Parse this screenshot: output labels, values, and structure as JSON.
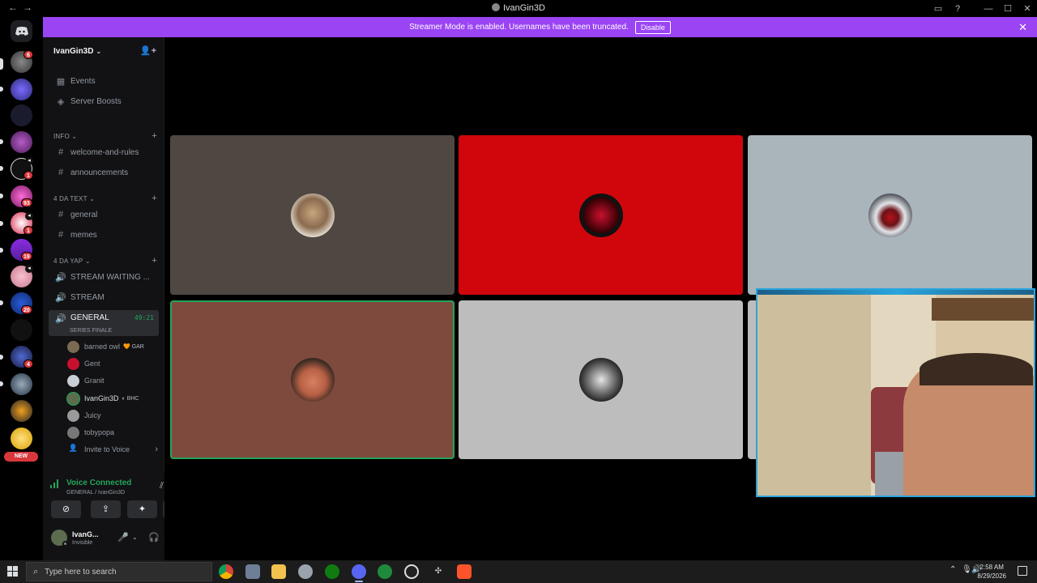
{
  "window": {
    "title": "IvanGin3D",
    "back_glyph": "←",
    "forward_glyph": "→",
    "inbox_glyph": "▭",
    "help_glyph": "?",
    "minimize_glyph": "—",
    "maximize_glyph": "☐",
    "close_glyph": "✕"
  },
  "banner": {
    "message": "Streamer Mode is enabled. Usernames have been truncated.",
    "disable_label": "Disable",
    "close_glyph": "✕",
    "color": "#9b44f4"
  },
  "servers": {
    "home_icon": "discord-logo-icon",
    "badges": [
      "6",
      "1",
      "93",
      "1",
      "19",
      "20",
      "4"
    ],
    "new_label": "NEW"
  },
  "sidebar": {
    "server_name": "IvanGin3D",
    "caret_glyph": "⌄",
    "invite_glyph": "👤+",
    "top_items": [
      {
        "label": "Events",
        "icon": "calendar-icon",
        "glyph": "▦"
      },
      {
        "label": "Server Boosts",
        "icon": "boost-icon",
        "glyph": "◈"
      }
    ],
    "categories": [
      {
        "name": "INFO",
        "caret": "⌄",
        "plus": "+"
      },
      {
        "name": "4 DA TEXT",
        "caret": "⌄",
        "plus": "+"
      },
      {
        "name": "4 DA YAP",
        "caret": "⌄",
        "plus": "+"
      }
    ],
    "text_channels_info": [
      "welcome-and-rules",
      "announcements"
    ],
    "text_channels_text": [
      "general",
      "memes"
    ],
    "voice_channels": [
      "STREAM WAITING ...",
      "STREAM"
    ],
    "active_voice": {
      "name": "GENERAL",
      "timer": "49:21",
      "status": "SERIES FINALE"
    },
    "members": [
      {
        "name": "barned owl",
        "tag": "🧡 GAR",
        "color": "#7b6a52"
      },
      {
        "name": "Gent",
        "tag": "",
        "color": "#c8102e"
      },
      {
        "name": "Granit",
        "tag": "",
        "color": "#c9ced4"
      },
      {
        "name": "IvanGin3D",
        "tag": "◐ BHC",
        "color": "#5b6c4f"
      },
      {
        "name": "Juicy",
        "tag": "",
        "color": "#9a9a9a"
      },
      {
        "name": "tobypopa",
        "tag": "",
        "color": "#777"
      }
    ],
    "invite_to_voice": "Invite to Voice",
    "chevron_right": "›",
    "hash_glyph": "#",
    "speaker_glyph": "🔊"
  },
  "voice_panel": {
    "title": "Voice Connected",
    "location": "GENERAL / IvanGin3D",
    "signal_glyph": "📶",
    "noise_glyph": "⫽",
    "disconnect_glyph": "☎",
    "buttons": [
      {
        "name": "camera-off-button",
        "glyph": "⊘"
      },
      {
        "name": "screen-share-button",
        "glyph": "⇪"
      },
      {
        "name": "activities-button",
        "glyph": "✦"
      },
      {
        "name": "soundboard-button",
        "glyph": "♪"
      }
    ]
  },
  "user_panel": {
    "name": "IvanG...",
    "status": "Invisible",
    "mic_glyph": "🎤",
    "headset_glyph": "🎧",
    "settings_glyph": "⚙",
    "caret_glyph": "⌄"
  },
  "tiles": [
    {
      "name": "tile-barned-owl",
      "bg": "#4f4842",
      "avatar": "#8a7256"
    },
    {
      "name": "tile-gent",
      "bg": "#d0060c",
      "avatar": "#1b1b1b"
    },
    {
      "name": "tile-granit",
      "bg": "#a9b4bb",
      "avatar": "#a44"
    },
    {
      "name": "tile-ivangin3d",
      "bg": "#7e4a3e",
      "avatar": "#3a2a22"
    },
    {
      "name": "tile-juicy",
      "bg": "#bdbdbd",
      "avatar": "#444"
    }
  ],
  "taskbar": {
    "search_placeholder": "Type here to search",
    "search_glyph": "⌕",
    "time": "2:58 AM",
    "date": "8/29/2026",
    "tray_up": "⌃",
    "tray_mic": "🎙",
    "tray_vol": "🔊"
  }
}
